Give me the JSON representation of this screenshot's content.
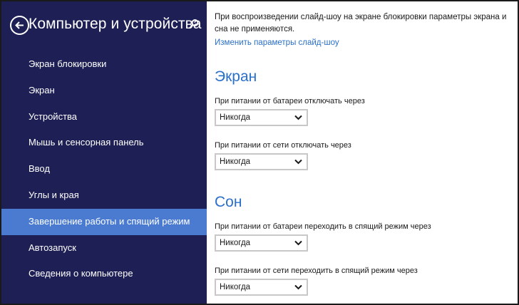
{
  "sidebar": {
    "title": "Компьютер и устройства",
    "items": [
      {
        "label": "Экран блокировки",
        "active": false
      },
      {
        "label": "Экран",
        "active": false
      },
      {
        "label": "Устройства",
        "active": false
      },
      {
        "label": "Мышь и сенсорная панель",
        "active": false
      },
      {
        "label": "Ввод",
        "active": false
      },
      {
        "label": "Углы и края",
        "active": false
      },
      {
        "label": "Завершение работы и спящий режим",
        "active": true
      },
      {
        "label": "Автозапуск",
        "active": false
      },
      {
        "label": "Сведения о компьютере",
        "active": false
      }
    ]
  },
  "content": {
    "note": "При воспроизведении слайд-шоу на экране блокировки параметры экрана и сна не применяются.",
    "link": "Изменить параметры слайд-шоу",
    "screen": {
      "title": "Экран",
      "battery_label": "При питании от батареи отключать через",
      "battery_value": "Никогда",
      "ac_label": "При питании от сети отключать через",
      "ac_value": "Никогда"
    },
    "sleep": {
      "title": "Сон",
      "battery_label": "При питании от батареи переходить в спящий режим через",
      "battery_value": "Никогда",
      "ac_label": "При питании от сети переходить в спящий режим через",
      "ac_value": "Никогда"
    }
  },
  "colors": {
    "sidebar_bg": "#1e2055",
    "active_item": "#4a7bd0",
    "accent": "#2a6fc9"
  },
  "icons": {
    "back": "back-arrow-icon",
    "search": "search-icon",
    "dropdown": "chevron-down-icon"
  }
}
